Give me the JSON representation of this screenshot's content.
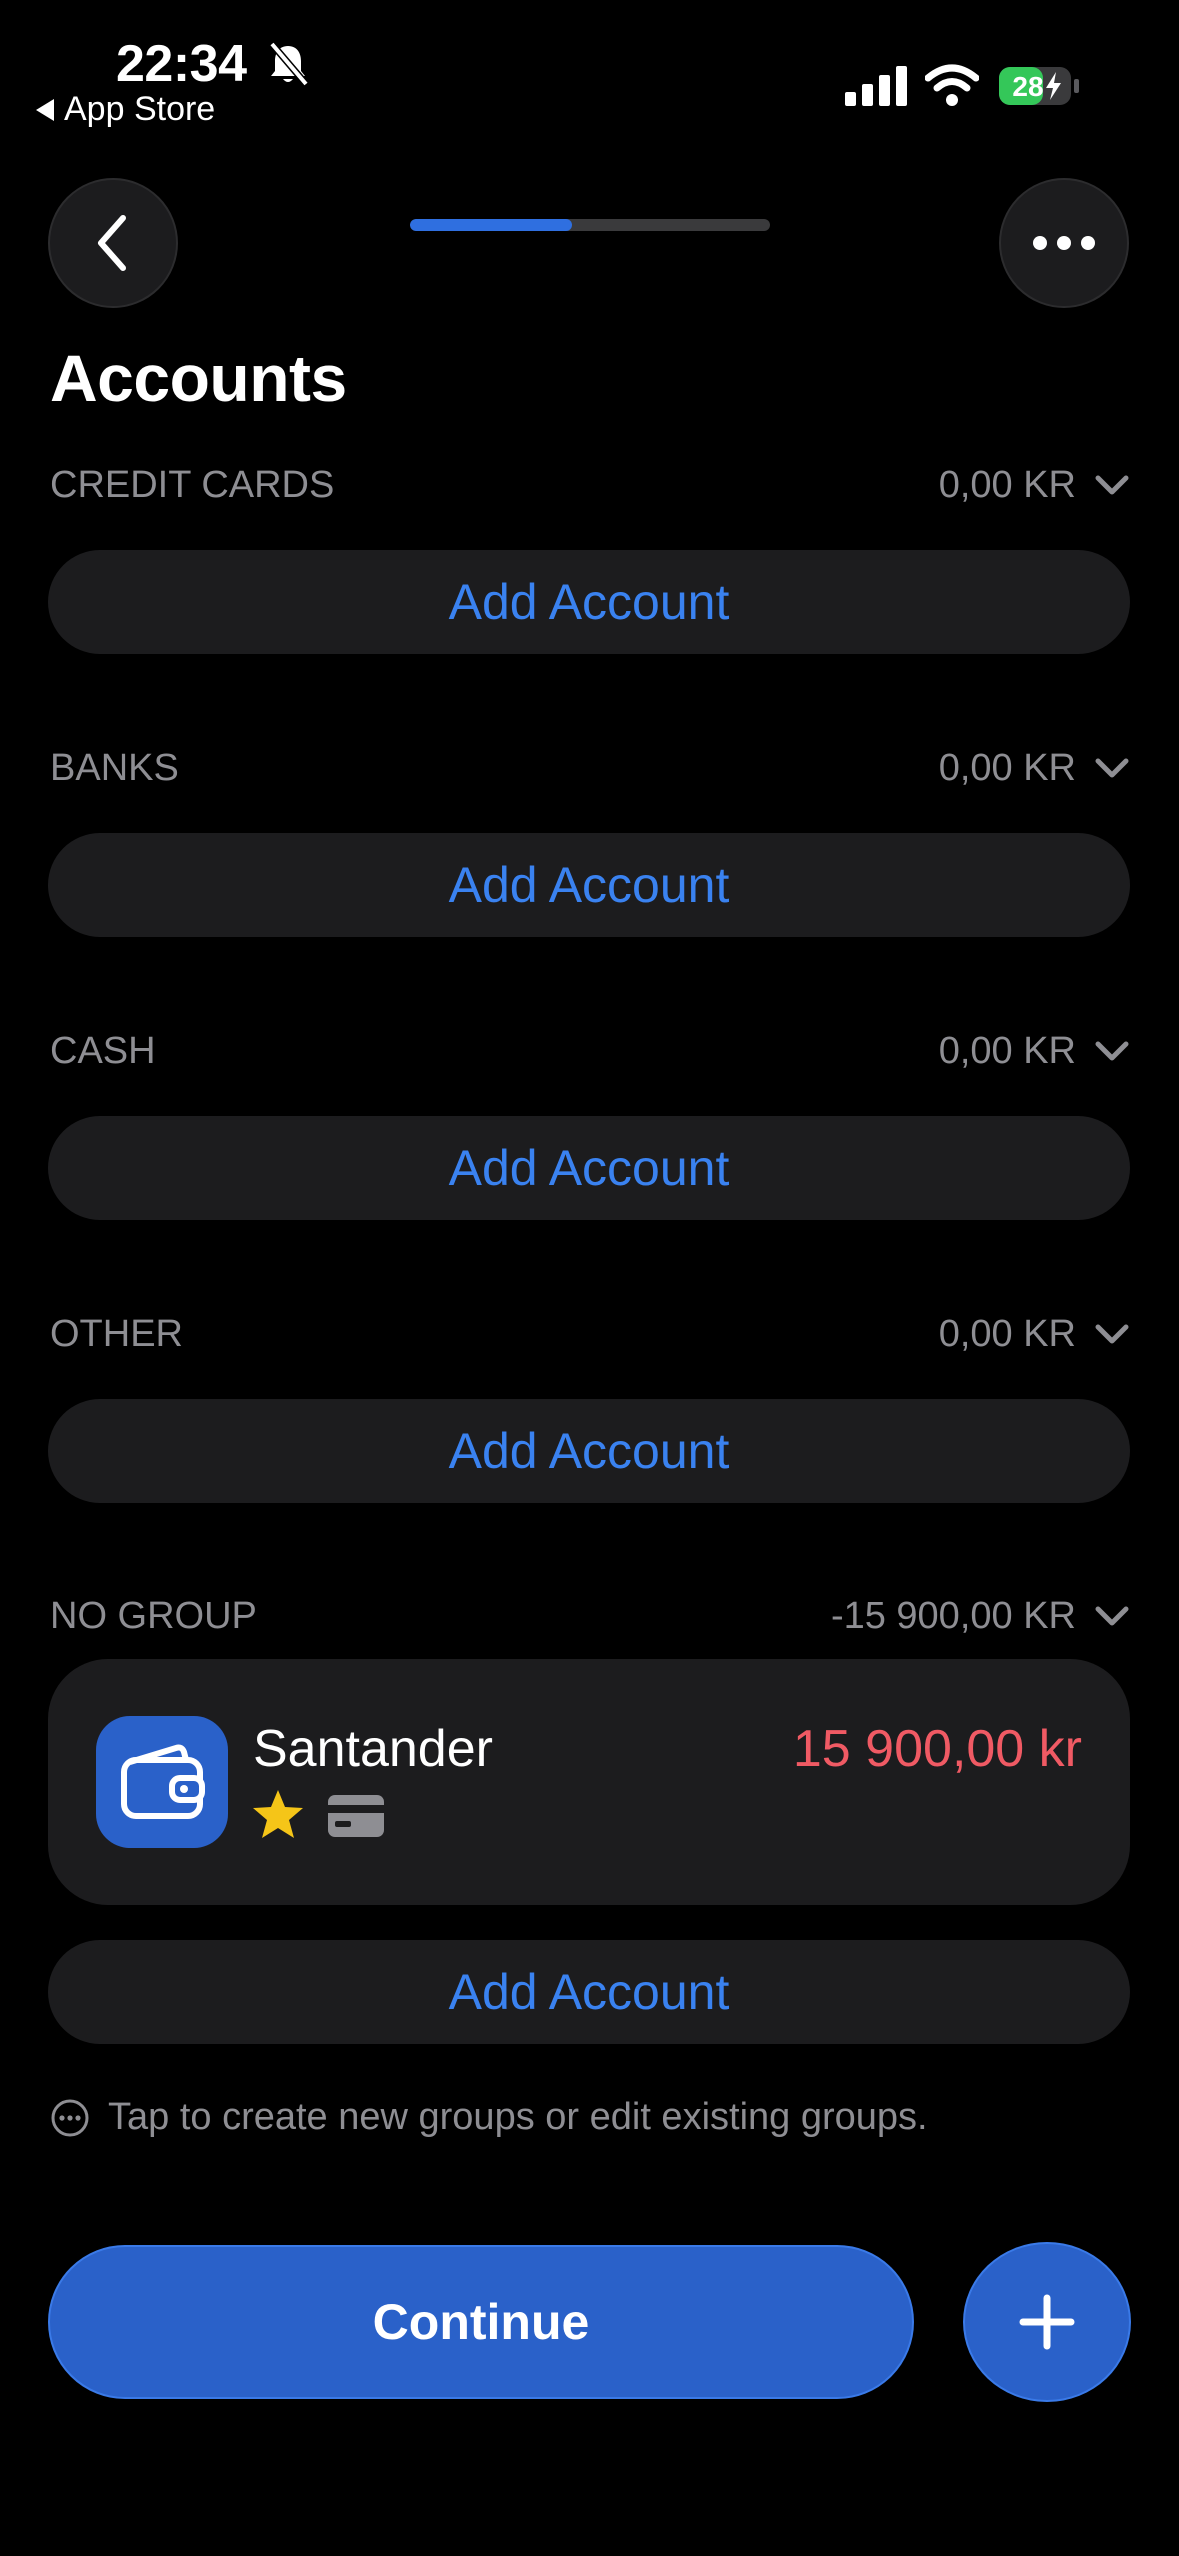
{
  "status_bar": {
    "time": "22:34",
    "back_app": "App Store",
    "battery": "28"
  },
  "header": {
    "title": "Accounts",
    "progress": 0.45
  },
  "groups": [
    {
      "name": "CREDIT CARDS",
      "total": "0,00 KR",
      "add_label": "Add Account"
    },
    {
      "name": "BANKS",
      "total": "0,00 KR",
      "add_label": "Add Account"
    },
    {
      "name": "CASH",
      "total": "0,00 KR",
      "add_label": "Add Account"
    },
    {
      "name": "OTHER",
      "total": "0,00 KR",
      "add_label": "Add Account"
    },
    {
      "name": "NO GROUP",
      "total": "-15 900,00 KR",
      "add_label": "Add Account",
      "accounts": [
        {
          "name": "Santander",
          "amount": "15 900,00 kr",
          "icon": "wallet-icon",
          "badges": [
            "star-icon",
            "card-icon"
          ]
        }
      ]
    }
  ],
  "hint": "Tap to create new groups or edit existing groups.",
  "actions": {
    "continue_label": "Continue"
  },
  "colors": {
    "accent": "#2a61c9",
    "link": "#3a82f0",
    "negative": "#f05a64",
    "star": "#f5c518"
  }
}
